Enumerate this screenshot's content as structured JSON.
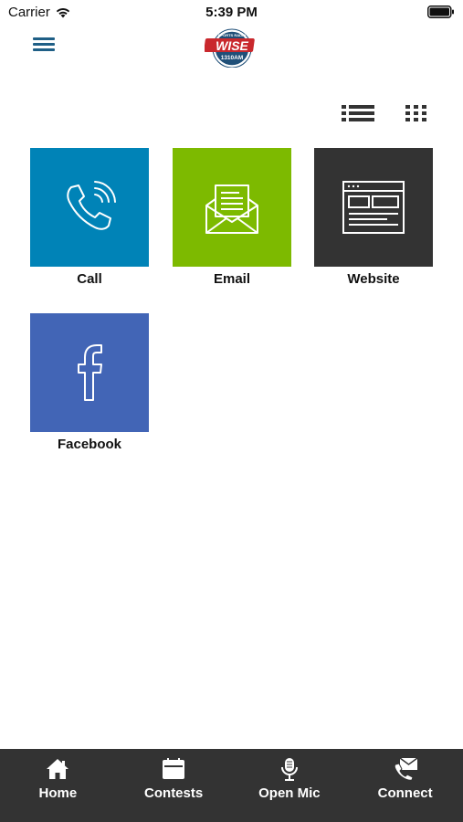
{
  "status_bar": {
    "carrier": "Carrier",
    "time": "5:39 PM",
    "wifi_icon": "wifi-icon",
    "battery_icon": "battery-icon"
  },
  "header": {
    "menu_icon": "hamburger-menu-icon",
    "logo": {
      "top_text": "SPORTS RADIO",
      "main_text": "WISE",
      "frequency": "1310AM",
      "colors": {
        "navy": "#1f4f78",
        "red": "#c9282d"
      }
    }
  },
  "view_toggle": {
    "list_icon": "list-view-icon",
    "grid_icon": "grid-view-icon"
  },
  "tiles": [
    {
      "label": "Call",
      "icon": "phone-icon",
      "color": "#0083b7"
    },
    {
      "label": "Email",
      "icon": "envelope-icon",
      "color": "#7dba00"
    },
    {
      "label": "Website",
      "icon": "browser-window-icon",
      "color": "#333333"
    },
    {
      "label": "Facebook",
      "icon": "facebook-icon",
      "color": "#4265b6"
    }
  ],
  "tab_bar": {
    "background": "#333333",
    "tabs": [
      {
        "label": "Home",
        "icon": "home-icon"
      },
      {
        "label": "Contests",
        "icon": "calendar-icon"
      },
      {
        "label": "Open Mic",
        "icon": "microphone-icon"
      },
      {
        "label": "Connect",
        "icon": "envelope-phone-icon"
      }
    ]
  }
}
